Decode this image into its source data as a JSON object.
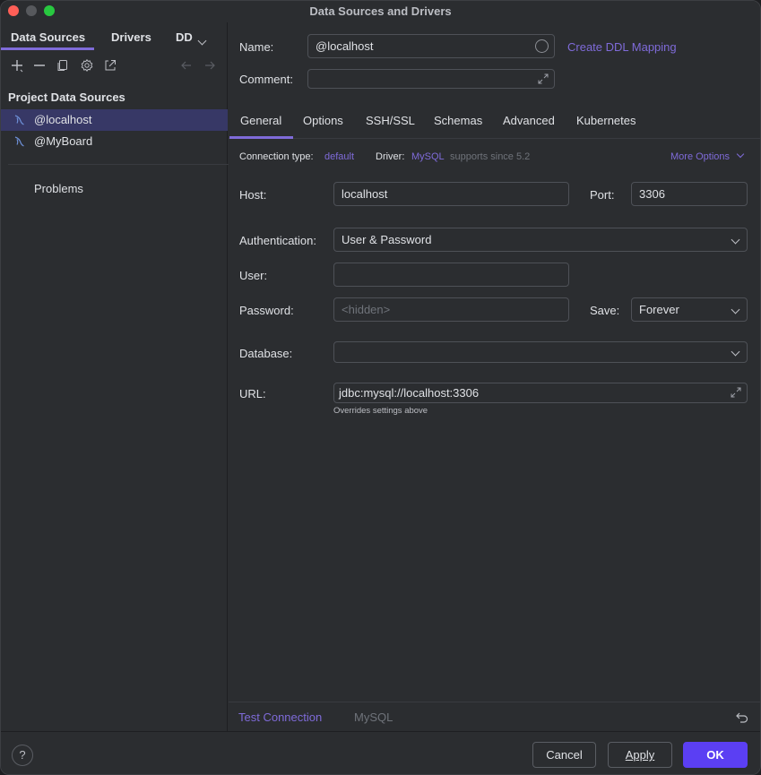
{
  "window": {
    "title": "Data Sources and Drivers"
  },
  "sidebar": {
    "tabs": [
      {
        "label": "Data Sources"
      },
      {
        "label": "Drivers"
      },
      {
        "label": "DD"
      }
    ],
    "section_title": "Project Data Sources",
    "items": [
      {
        "label": "@localhost",
        "selected": true,
        "icon": "mysql-dolphin-icon"
      },
      {
        "label": "@MyBoard",
        "selected": false,
        "icon": "mysql-dolphin-icon"
      }
    ],
    "problems_label": "Problems",
    "toolbar_icons": [
      "add-icon",
      "remove-icon",
      "duplicate-icon",
      "settings-icon",
      "open-external-icon",
      "back-arrow-icon",
      "forward-arrow-icon"
    ]
  },
  "form": {
    "name_label": "Name:",
    "name_value": "@localhost",
    "ddl_link": "Create DDL Mapping",
    "comment_label": "Comment:",
    "comment_value": "",
    "tabs": [
      {
        "label": "General",
        "active": true
      },
      {
        "label": "Options"
      },
      {
        "label": "SSH/SSL"
      },
      {
        "label": "Schemas"
      },
      {
        "label": "Advanced"
      },
      {
        "label": "Kubernetes"
      }
    ],
    "conn_type_label": "Connection type:",
    "conn_type_value": "default",
    "driver_label": "Driver:",
    "driver_value": "MySQL",
    "driver_note": "supports since 5.2",
    "more_options": "More Options",
    "host_label": "Host:",
    "host_value": "localhost",
    "port_label": "Port:",
    "port_value": "3306",
    "auth_label": "Authentication:",
    "auth_value": "User & Password",
    "user_label": "User:",
    "user_value": "",
    "password_label": "Password:",
    "password_placeholder": "<hidden>",
    "save_label": "Save:",
    "save_value": "Forever",
    "database_label": "Database:",
    "database_value": "",
    "url_label": "URL:",
    "url_value": "jdbc:mysql://localhost:3306",
    "url_hint": "Overrides settings above"
  },
  "main_footer": {
    "test_connection": "Test Connection",
    "driver_name": "MySQL"
  },
  "footer": {
    "help": "?",
    "cancel": "Cancel",
    "apply": "Apply",
    "ok": "OK"
  },
  "colors": {
    "accent": "#7f6bd9",
    "primary_button": "#5b3ff3",
    "selection": "#373866"
  }
}
